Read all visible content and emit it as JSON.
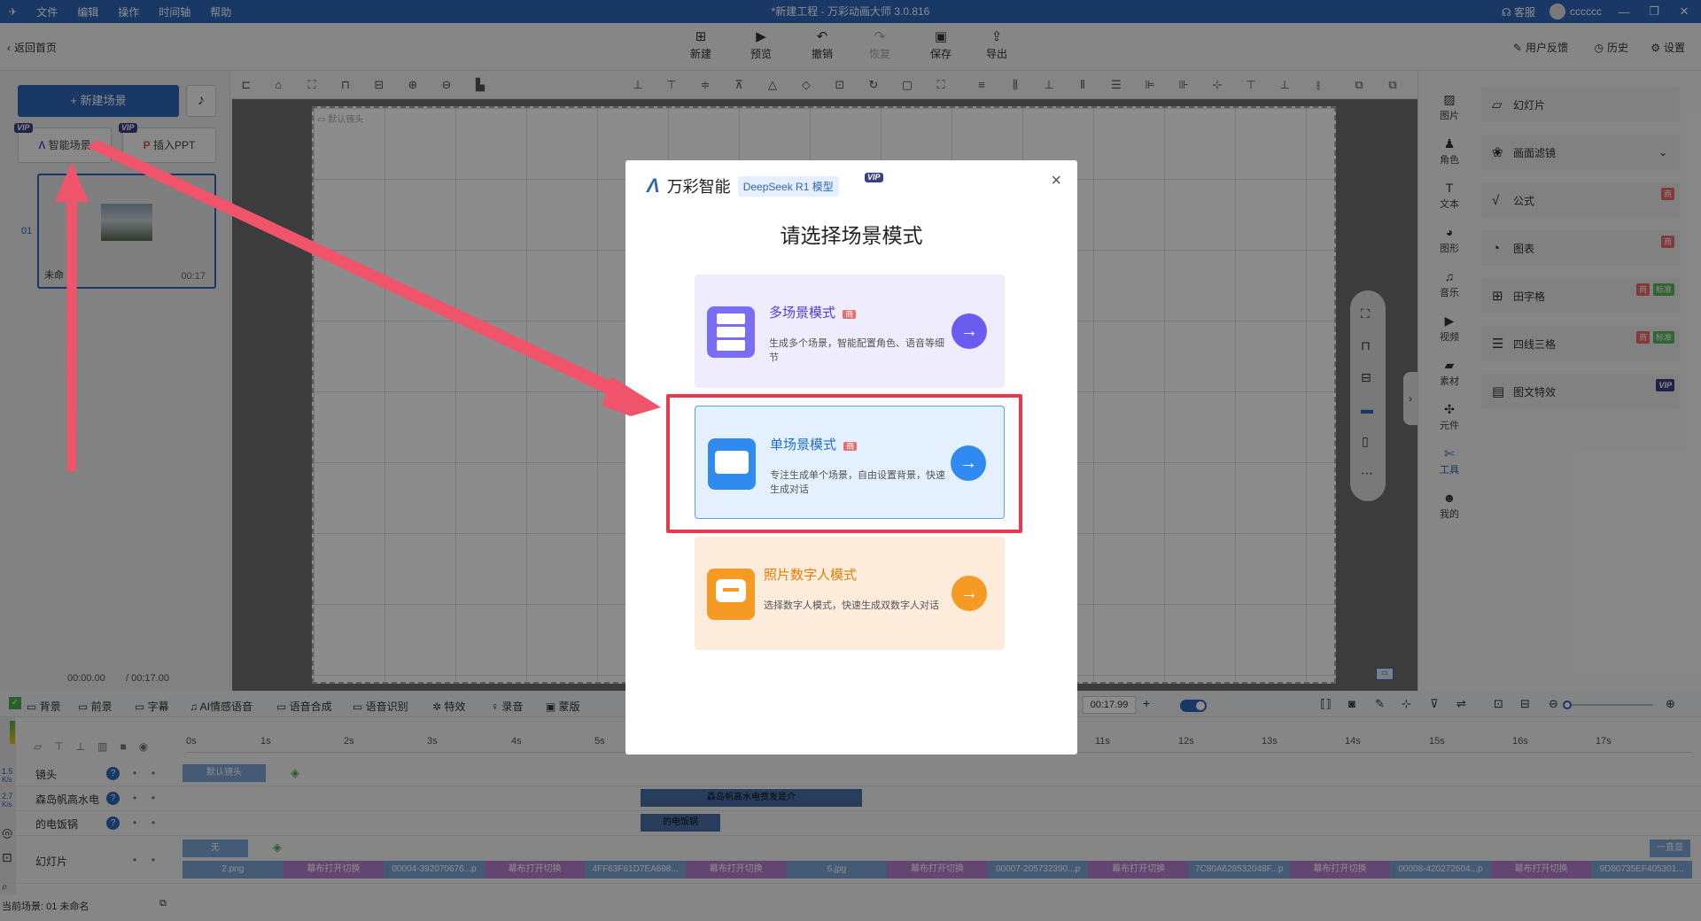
{
  "titlebar": {
    "menu": [
      "文件",
      "编辑",
      "操作",
      "时间轴",
      "帮助"
    ],
    "title": "*新建工程 - 万彩动画大师 3.0.816",
    "service": "客服",
    "username": "cccccc"
  },
  "toolbar": {
    "back": "返回首页",
    "buttons": [
      "新建",
      "预览",
      "撤销",
      "恢复",
      "保存",
      "导出"
    ],
    "feedback": "用户反馈",
    "history": "历史",
    "settings": "设置"
  },
  "left": {
    "new_scene": "+ 新建场景",
    "smart_scene": "智能场景",
    "insert_ppt": "插入PPT",
    "vip": "VIP",
    "scene_index": "01",
    "scene_name": "未命",
    "scene_duration": "00:17",
    "time_current": "00:00.00",
    "time_total": "/ 00:17.00"
  },
  "canvas": {
    "default_camera": "默认镜头"
  },
  "right_icons": [
    "图片",
    "角色",
    "文本",
    "图形",
    "音乐",
    "视频",
    "素材",
    "元件",
    "工具",
    "我的"
  ],
  "right_panel": [
    {
      "label": "幻灯片",
      "tags": []
    },
    {
      "label": "画面滤镜",
      "tags": []
    },
    {
      "label": "公式",
      "tags": [
        "商"
      ]
    },
    {
      "label": "图表",
      "tags": [
        "商"
      ]
    },
    {
      "label": "田字格",
      "tags": [
        "商",
        "标准"
      ]
    },
    {
      "label": "四线三格",
      "tags": [
        "商",
        "标准"
      ]
    },
    {
      "label": "图文特效",
      "tags": [
        "VIP"
      ]
    }
  ],
  "timeline": {
    "tabs": [
      "背景",
      "前景",
      "字幕",
      "AI情感语音",
      "语音合成",
      "语音识别",
      "特效",
      "录音",
      "蒙版"
    ],
    "time_display": "00:17.99",
    "ticks": [
      "0s",
      "1s",
      "2s",
      "3s",
      "4s",
      "5s",
      "11s",
      "12s",
      "13s",
      "14s",
      "15s",
      "16s",
      "17s"
    ],
    "tracks": [
      "镜头",
      "森岛帆高水电",
      "的电饭锅",
      "幻灯片"
    ],
    "camera_clip": "默认镜头",
    "audio_clip_1": "森岛帆高水电费发是介",
    "audio_clip_2": "的电饭锅",
    "bg_clip": "无",
    "always_show": "一直显",
    "slide_clips": [
      "2.png",
      "幕布打开切换",
      "00004-392070676...p",
      "幕布打开切换",
      "4FF63F61D7EA698...",
      "幕布打开切换",
      "6.jpg",
      "幕布打开切换",
      "00007-205732390...p",
      "幕布打开切换",
      "7C80A628532048F...p",
      "幕布打开切换",
      "00008-420272604...p",
      "幕布打开切换",
      "9D80735EF405301..."
    ],
    "speed_1": "1.5",
    "speed_2": "2.7",
    "speed_unit": "K/s",
    "status": "当前场景: 01   未命名"
  },
  "modal": {
    "brand": "万彩智能",
    "model_badge": "DeepSeek R1 模型",
    "vip": "VIP",
    "close": "×",
    "heading": "请选择场景模式",
    "badge_shang": "商",
    "modes": [
      {
        "title": "多场景模式",
        "desc": "生成多个场景，智能配置角色、语音等细节",
        "accent": "#6b5cf0"
      },
      {
        "title": "单场景模式",
        "desc": "专注生成单个场景，自由设置背景，快速生成对话",
        "accent": "#2f8bf0"
      },
      {
        "title": "照片数字人模式",
        "desc": "选择数字人模式，快速生成双数字人对话",
        "accent": "#f59a23"
      }
    ]
  },
  "colors": {
    "brand": "#2f66b8",
    "highlight": "#e83a4f",
    "arrow": "#f0546a"
  }
}
